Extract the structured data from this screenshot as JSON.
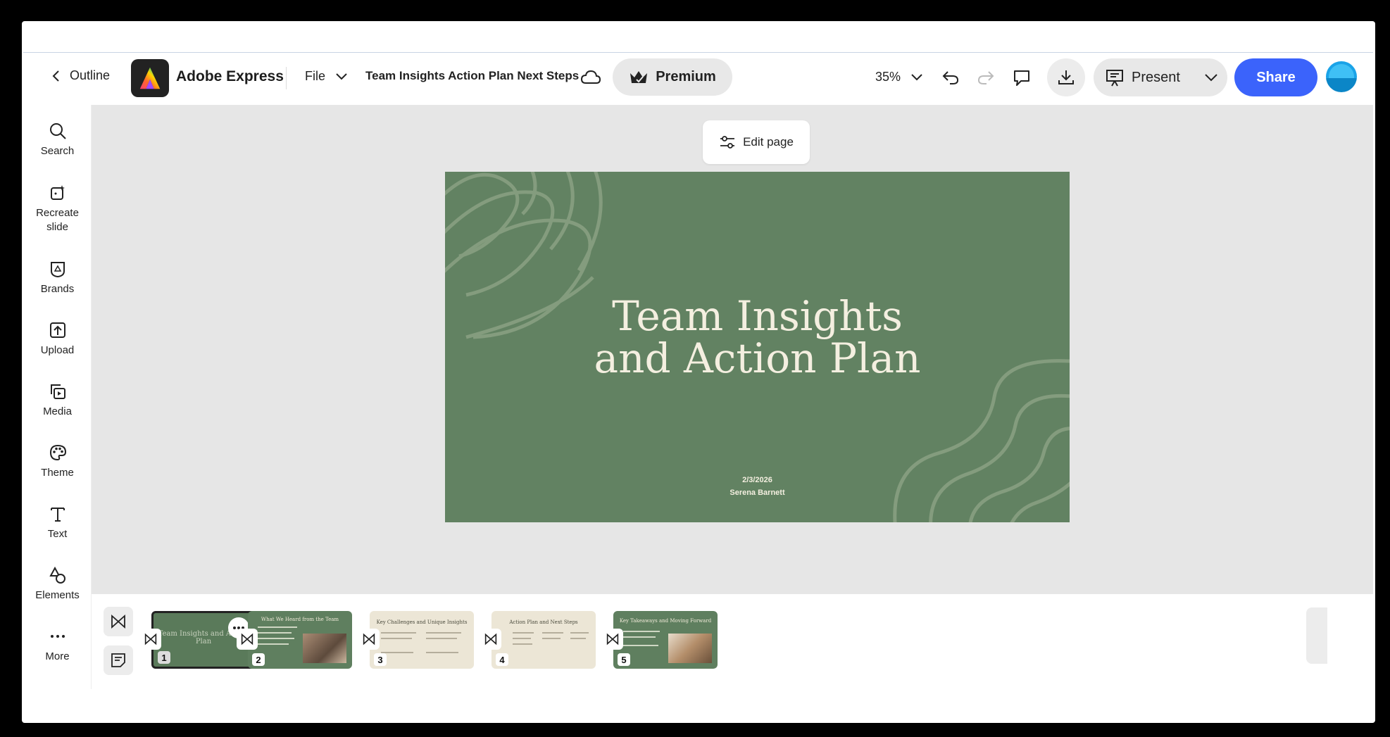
{
  "header": {
    "outline_label": "Outline",
    "app_name": "Adobe Express",
    "file_label": "File",
    "doc_title": "Team Insights Action Plan Next Steps",
    "premium_label": "Premium",
    "zoom": "35%",
    "present_label": "Present",
    "share_label": "Share"
  },
  "rail": [
    {
      "label": "Search",
      "icon": "search-icon"
    },
    {
      "label": "Recreate\nslide",
      "icon": "recreate-slide-icon"
    },
    {
      "label": "Brands",
      "icon": "brands-icon"
    },
    {
      "label": "Upload",
      "icon": "upload-icon"
    },
    {
      "label": "Media",
      "icon": "media-icon"
    },
    {
      "label": "Theme",
      "icon": "palette-icon"
    },
    {
      "label": "Text",
      "icon": "text-icon"
    },
    {
      "label": "Elements",
      "icon": "shapes-icon"
    },
    {
      "label": "More",
      "icon": "more-icon"
    }
  ],
  "canvas": {
    "edit_page_label": "Edit page",
    "slide": {
      "title_line1": "Team Insights",
      "title_line2": "and Action Plan",
      "date": "2/3/2026",
      "author": "Serena Barnett",
      "bg_color": "#628262"
    }
  },
  "filmstrip": {
    "pages": [
      {
        "num": "1",
        "title": "Team Insights and Action Plan",
        "active": true
      },
      {
        "num": "2",
        "title": "What We Heard from the Team",
        "active": false
      },
      {
        "num": "3",
        "title": "Key Challenges and Unique Insights",
        "active": false
      },
      {
        "num": "4",
        "title": "Action Plan and Next Steps",
        "active": false
      },
      {
        "num": "5",
        "title": "Key Takeaways and Moving Forward",
        "active": false
      }
    ]
  },
  "colors": {
    "accent": "#3b63fb",
    "slide_green": "#628262",
    "slide_cream": "#ece6d6"
  }
}
